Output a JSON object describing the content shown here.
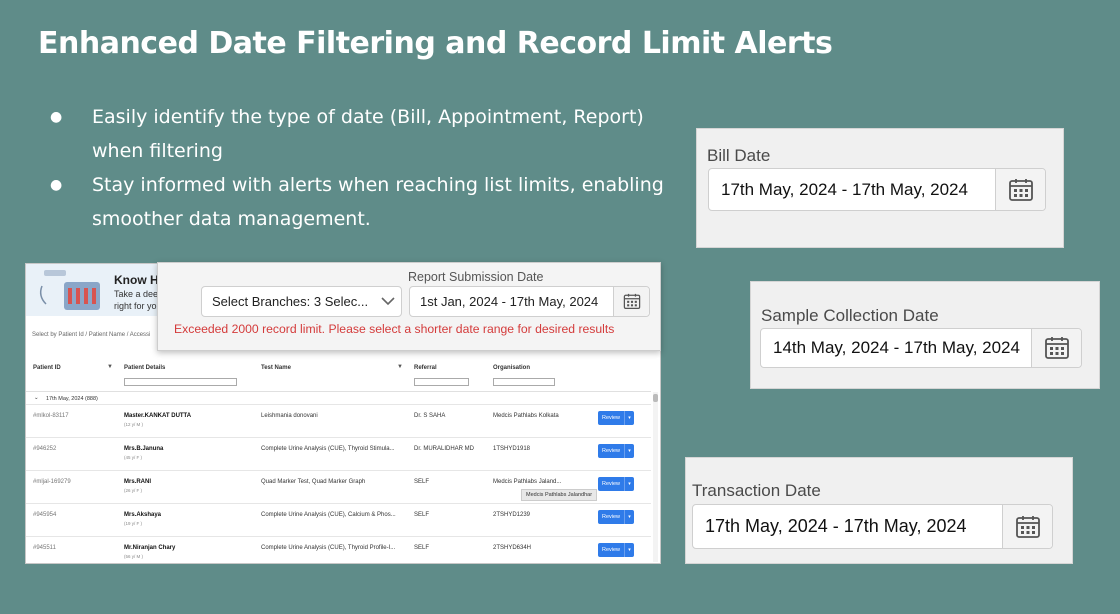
{
  "slide": {
    "title": "Enhanced Date Filtering and Record Limit Alerts",
    "bullets": [
      {
        "dot": "●",
        "text": "Easily identify the type of date (Bill, Appointment, Report) when filtering"
      },
      {
        "dot": "●",
        "text": "Stay informed with alerts when reaching list limits, enabling smoother data management."
      }
    ]
  },
  "date_cards": [
    {
      "label": "Bill Date",
      "value": "17th May, 2024 - 17th May, 2024",
      "icon": "calendar-icon"
    },
    {
      "label": "Sample Collection Date",
      "value": "14th May, 2024 - 17th May, 2024",
      "icon": "calendar-icon"
    },
    {
      "label": "Transaction Date",
      "value": "17th May, 2024 - 17th May, 2024",
      "icon": "calendar-icon"
    }
  ],
  "overlay": {
    "date_label": "Report Submission Date",
    "branch_select": "Select Branches: 3 Selec...",
    "date_value": "1st Jan, 2024 - 17th May, 2024",
    "error": "Exceeded 2000 record limit. Please select a shorter date range for desired results",
    "error_color": "#d43b3b"
  },
  "panel": {
    "banner_title": "Know Ho",
    "banner_text_1": "Take a deep",
    "banner_text_2": "right for you",
    "search_hint": "Select by Patient Id / Patient Name / Accessi",
    "columns": [
      "Patient ID",
      "Patient Details",
      "Test Name",
      "Referral",
      "Organisation"
    ],
    "group_label": "17th May, 2024 (888)",
    "review_label": "Review",
    "rows": [
      {
        "id": "#mlkol-83117",
        "name": "Master.KANKAT DUTTA",
        "sub": "(12 y/ M )",
        "test": "Leishmania donovani",
        "referral": "Dr. S SAHA",
        "org": "Medcis Pathlabs Kolkata"
      },
      {
        "id": "#946252",
        "name": "Mrs.B.Januna",
        "sub": "(45 y/ F )",
        "test": "Complete Urine Analysis (CUE), Thyroid Stimula...",
        "referral": "Dr. MURALIDHAR MD",
        "org": "1TSHYD1918"
      },
      {
        "id": "#mljal-169279",
        "name": "Mrs.RANI",
        "sub": "(26 y/ F )",
        "test": "Quad Marker Test, Quad Marker Graph",
        "referral": "SELF",
        "org": "Medcis Pathlabs Jaland..."
      },
      {
        "id": "#945954",
        "name": "Mrs.Akshaya",
        "sub": "(19 y/ F )",
        "test": "Complete Urine Analysis (CUE), Calcium & Phos...",
        "referral": "SELF",
        "org": "2TSHYD1239"
      },
      {
        "id": "#945511",
        "name": "Mr.Niranjan Chary",
        "sub": "(56 y/ M )",
        "test": "Complete Urine Analysis (CUE), Thyroid Profile-I...",
        "referral": "SELF",
        "org": "2TSHYD634H"
      }
    ],
    "tooltip": "Medcis Pathlabs Jalandhar"
  }
}
